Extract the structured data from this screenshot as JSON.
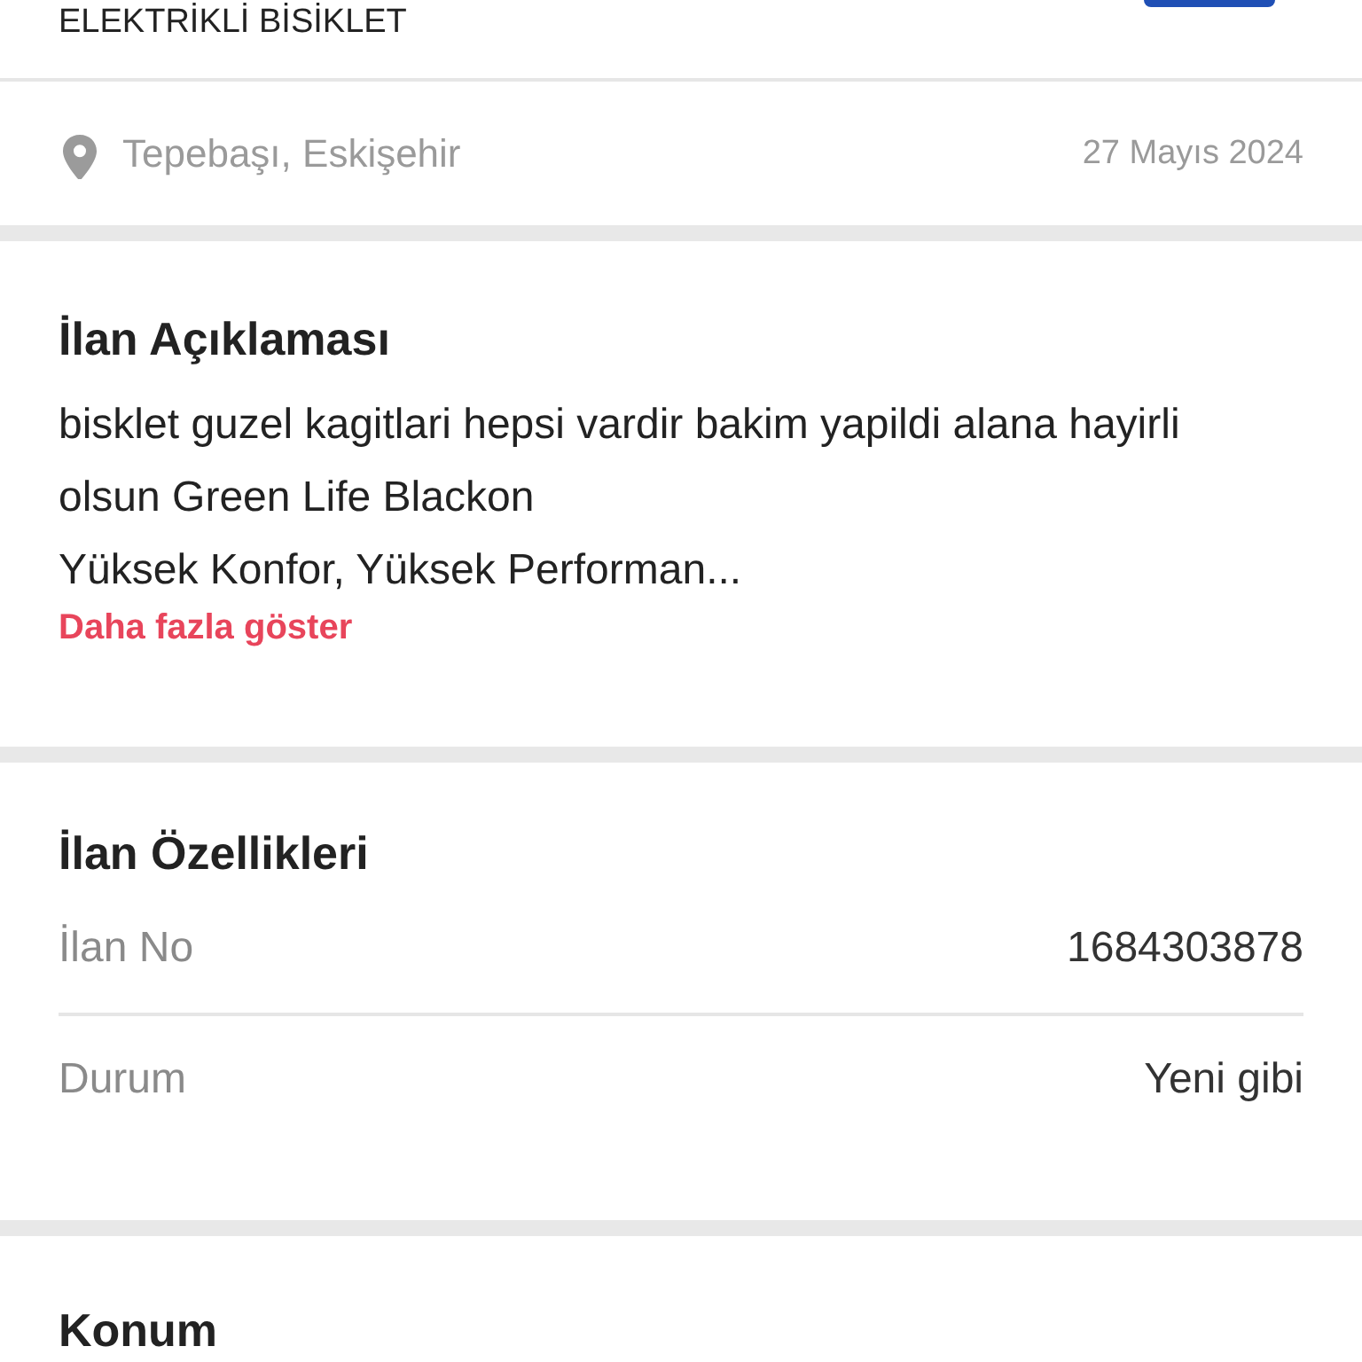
{
  "header": {
    "title": "ELEKTRİKLİ BİSİKLET"
  },
  "location": {
    "place": "Tepebaşı, Eskişehir",
    "date": "27 Mayıs 2024"
  },
  "description": {
    "title": "İlan Açıklaması",
    "text": "bisklet guzel kagitlari hepsi vardir bakim yapildi alana hayirli olsun Green Life Blackon\nYüksek Konfor, Yüksek Performan...",
    "more": "Daha fazla göster"
  },
  "features": {
    "title": "İlan Özellikleri",
    "rows": [
      {
        "label": "İlan No",
        "value": "1684303878"
      },
      {
        "label": "Durum",
        "value": "Yeni gibi"
      }
    ]
  },
  "location_section": {
    "title": "Konum"
  }
}
